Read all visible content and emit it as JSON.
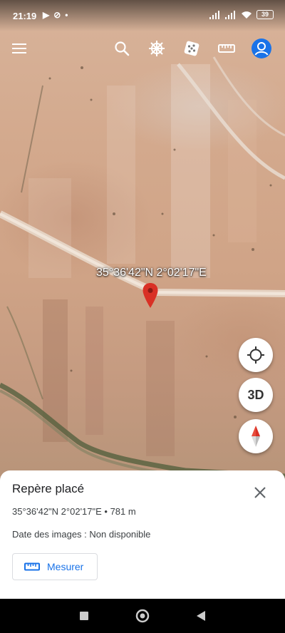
{
  "status_bar": {
    "time": "21:19",
    "battery": "39",
    "icons": [
      "play-icon",
      "no-entry-icon",
      "dot-icon",
      "signal-icon",
      "signal-icon",
      "wifi-icon",
      "battery-icon"
    ]
  },
  "toolbar": {
    "icons": [
      "menu-icon",
      "search-icon",
      "voyager-icon",
      "random-dice-icon",
      "ruler-icon",
      "account-icon"
    ]
  },
  "map": {
    "pin_label": "35°36'42\"N 2°02'17\"E",
    "buttons": {
      "locate_icon": "crosshair-icon",
      "three_d_label": "3D",
      "compass_icon": "compass-icon"
    }
  },
  "sheet": {
    "title": "Repère placé",
    "coordinates": "35°36'42\"N 2°02'17\"E • 781 m",
    "imagery_date": "Date des images : Non disponible",
    "measure_label": "Mesurer"
  },
  "colors": {
    "accent": "#1a73e8",
    "pin": "#d93025"
  }
}
